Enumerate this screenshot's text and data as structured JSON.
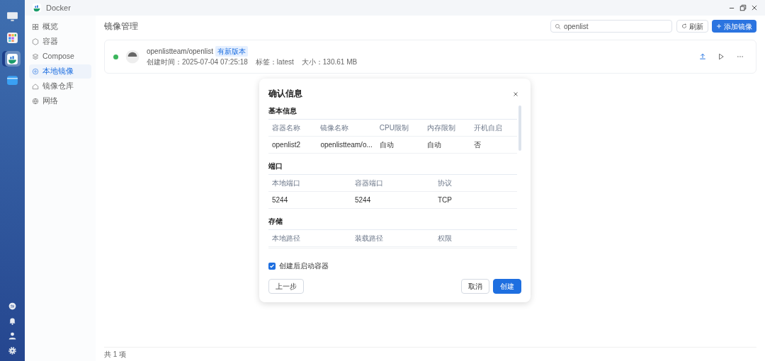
{
  "window": {
    "title": "Docker"
  },
  "dock": {
    "apps": [
      {
        "kind": "monitor",
        "selected": false
      },
      {
        "kind": "grid",
        "selected": false
      },
      {
        "kind": "docker",
        "selected": true
      },
      {
        "kind": "folder",
        "selected": false
      }
    ],
    "tray": [
      {
        "kind": "globe"
      },
      {
        "kind": "bell"
      },
      {
        "kind": "user"
      },
      {
        "kind": "gear"
      }
    ]
  },
  "sidebar": {
    "items": [
      {
        "kind": "overview",
        "label": "概览",
        "selected": false
      },
      {
        "kind": "container",
        "label": "容器",
        "selected": false
      },
      {
        "kind": "compose",
        "label": "Compose",
        "selected": false
      },
      {
        "kind": "image",
        "label": "本地镜像",
        "selected": true
      },
      {
        "kind": "registry",
        "label": "镜像仓库",
        "selected": false
      },
      {
        "kind": "network",
        "label": "网络",
        "selected": false
      }
    ]
  },
  "page": {
    "title": "镜像管理",
    "search": {
      "value": "openlist"
    },
    "refresh": "刷新",
    "add": "添加镜像",
    "images": [
      {
        "name": "openlistteam/openlist",
        "badge": "有新版本",
        "created": "创建时间：2025-07-04 07:25:18",
        "tag": "标签：latest",
        "size": "大小：130.61 MB",
        "running": true
      }
    ],
    "footer": "共 1 项"
  },
  "dialog": {
    "title": "确认信息",
    "sections": [
      {
        "title": "基本信息",
        "columns": [
          "容器名称",
          "镜像名称",
          "CPU限制",
          "内存限制",
          "开机自启"
        ],
        "rows": [
          [
            "openlist2",
            "openlistteam/o...",
            "自动",
            "自动",
            "否"
          ]
        ]
      },
      {
        "title": "端口",
        "columns": [
          "本地端口",
          "容器端口",
          "协议"
        ],
        "rows": [
          [
            "5244",
            "5244",
            "TCP"
          ]
        ]
      },
      {
        "title": "存储",
        "columns": [
          "本地路径",
          "装载路径",
          "权限"
        ]
      }
    ],
    "checkbox": {
      "label": "创建后启动容器",
      "checked": true
    },
    "back": "上一步",
    "cancel": "取消",
    "create": "创建"
  }
}
